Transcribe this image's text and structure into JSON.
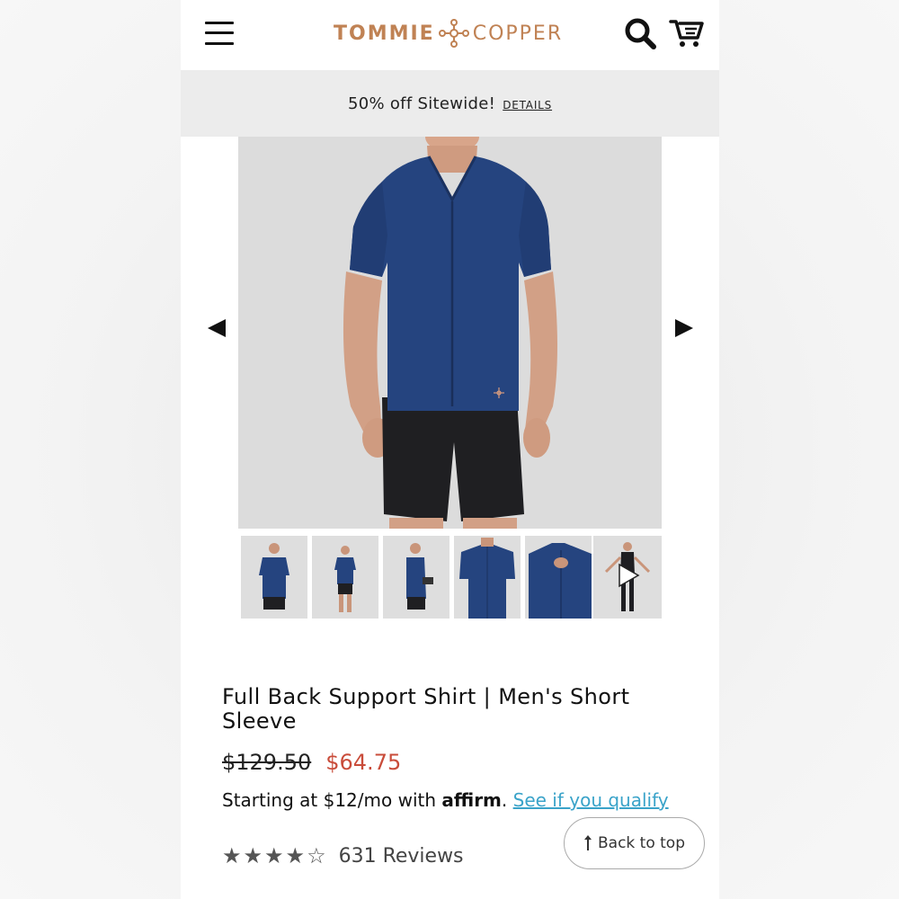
{
  "header": {
    "brand_left": "TOMMIE",
    "brand_right": "COPPER",
    "brand_color": "#c08254"
  },
  "promo": {
    "text": "50% off Sitewide!",
    "link": "DETAILS"
  },
  "gallery": {
    "thumbnails": [
      {
        "view": "front"
      },
      {
        "view": "front-full"
      },
      {
        "view": "side"
      },
      {
        "view": "back"
      },
      {
        "view": "closeup"
      },
      {
        "view": "video",
        "icon": "play-icon"
      }
    ]
  },
  "product": {
    "title": "Full Back Support Shirt | Men's Short Sleeve",
    "price_original": "$129.50",
    "price_sale": "$64.75",
    "sale_color": "#c94c3a",
    "affirm_prefix": "Starting at $12/mo with",
    "affirm_brand": "affirm",
    "affirm_suffix": ".",
    "affirm_link": "See if you qualify",
    "rating": 4,
    "rating_max": 5,
    "reviews_text": "631 Reviews"
  },
  "back_to_top": {
    "label": "Back to top"
  }
}
